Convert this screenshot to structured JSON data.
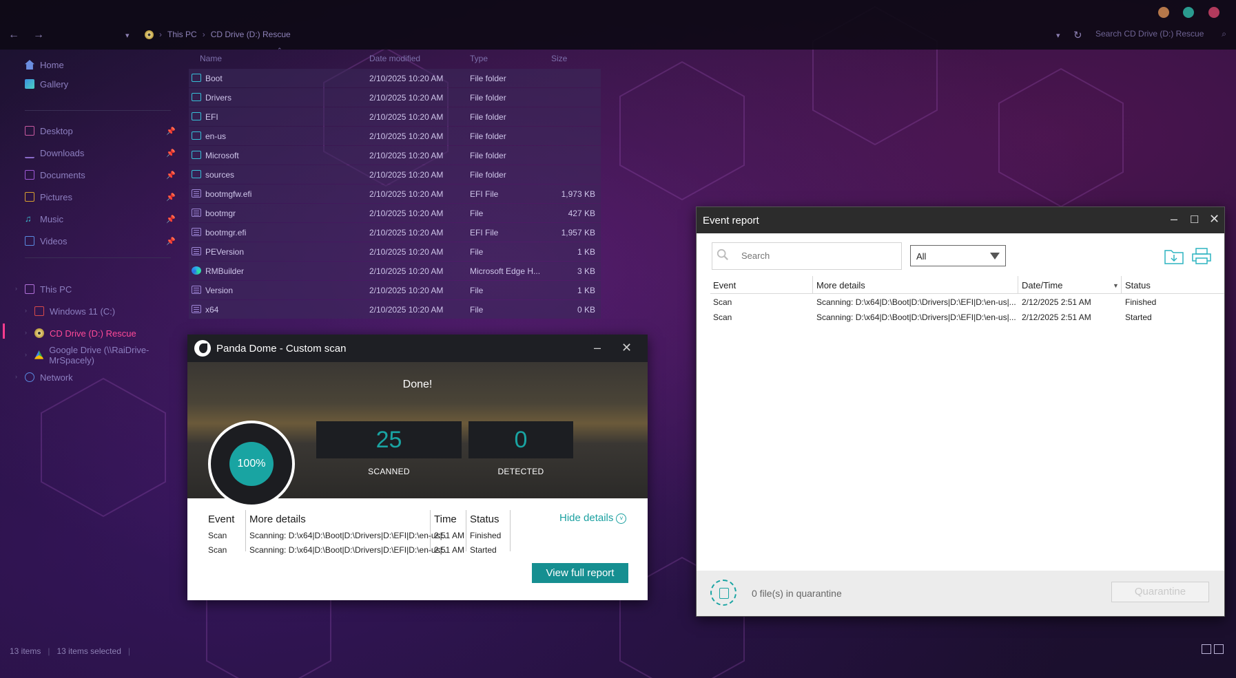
{
  "explorer": {
    "breadcrumb": [
      "This PC",
      "CD Drive (D:) Rescue"
    ],
    "search_placeholder": "Search CD Drive (D:) Rescue",
    "sidebar": {
      "top": [
        {
          "label": "Home",
          "icon": "home-icon"
        },
        {
          "label": "Gallery",
          "icon": "gallery-icon"
        }
      ],
      "pinned": [
        {
          "label": "Desktop",
          "icon": "desktop-icon"
        },
        {
          "label": "Downloads",
          "icon": "downloads-icon"
        },
        {
          "label": "Documents",
          "icon": "documents-icon"
        },
        {
          "label": "Pictures",
          "icon": "pictures-icon"
        },
        {
          "label": "Music",
          "icon": "music-icon"
        },
        {
          "label": "Videos",
          "icon": "videos-icon"
        }
      ],
      "tree": [
        {
          "label": "This PC",
          "icon": "pc-icon"
        },
        {
          "label": "Windows 11 (C:)",
          "icon": "drive-icon"
        },
        {
          "label": "CD Drive (D:) Rescue",
          "icon": "cd-icon",
          "selected": true
        },
        {
          "label": "Google Drive (\\\\RaiDrive-MrSpacely)",
          "icon": "google-drive-icon"
        },
        {
          "label": "Network",
          "icon": "network-icon"
        }
      ]
    },
    "columns": {
      "name": "Name",
      "date": "Date modified",
      "type": "Type",
      "size": "Size"
    },
    "files": [
      {
        "name": "Boot",
        "date": "2/10/2025 10:20 AM",
        "type": "File folder",
        "size": "",
        "icon": "folder"
      },
      {
        "name": "Drivers",
        "date": "2/10/2025 10:20 AM",
        "type": "File folder",
        "size": "",
        "icon": "folder"
      },
      {
        "name": "EFI",
        "date": "2/10/2025 10:20 AM",
        "type": "File folder",
        "size": "",
        "icon": "folder"
      },
      {
        "name": "en-us",
        "date": "2/10/2025 10:20 AM",
        "type": "File folder",
        "size": "",
        "icon": "folder"
      },
      {
        "name": "Microsoft",
        "date": "2/10/2025 10:20 AM",
        "type": "File folder",
        "size": "",
        "icon": "folder"
      },
      {
        "name": "sources",
        "date": "2/10/2025 10:20 AM",
        "type": "File folder",
        "size": "",
        "icon": "folder"
      },
      {
        "name": "bootmgfw.efi",
        "date": "2/10/2025 10:20 AM",
        "type": "EFI File",
        "size": "1,973 KB",
        "icon": "file"
      },
      {
        "name": "bootmgr",
        "date": "2/10/2025 10:20 AM",
        "type": "File",
        "size": "427 KB",
        "icon": "file"
      },
      {
        "name": "bootmgr.efi",
        "date": "2/10/2025 10:20 AM",
        "type": "EFI File",
        "size": "1,957 KB",
        "icon": "file"
      },
      {
        "name": "PEVersion",
        "date": "2/10/2025 10:20 AM",
        "type": "File",
        "size": "1 KB",
        "icon": "file"
      },
      {
        "name": "RMBuilder",
        "date": "2/10/2025 10:20 AM",
        "type": "Microsoft Edge H...",
        "size": "3 KB",
        "icon": "edge"
      },
      {
        "name": "Version",
        "date": "2/10/2025 10:20 AM",
        "type": "File",
        "size": "1 KB",
        "icon": "file"
      },
      {
        "name": "x64",
        "date": "2/10/2025 10:20 AM",
        "type": "File",
        "size": "0 KB",
        "icon": "file"
      }
    ],
    "status": {
      "items": "13 items",
      "selected": "13 items selected"
    }
  },
  "panda": {
    "title": "Panda Dome - Custom scan",
    "done": "Done!",
    "progress_pct": "100%",
    "progress_value": 1.0,
    "scanned_num": "25",
    "scanned_label": "SCANNED",
    "detected_num": "0",
    "detected_label": "DETECTED",
    "headers": {
      "event": "Event",
      "details": "More details",
      "time": "Time",
      "status": "Status"
    },
    "rows": [
      {
        "event": "Scan",
        "details": "Scanning: D:\\x64|D:\\Boot|D:\\Drivers|D:\\EFI|D:\\en-us|...",
        "time": "2:51 AM",
        "status": "Finished"
      },
      {
        "event": "Scan",
        "details": "Scanning: D:\\x64|D:\\Boot|D:\\Drivers|D:\\EFI|D:\\en-us|...",
        "time": "2:51 AM",
        "status": "Started"
      }
    ],
    "hide_details": "Hide details",
    "view_full_report": "View full report"
  },
  "event_report": {
    "title": "Event report",
    "search_placeholder": "Search",
    "filter_value": "All",
    "headers": {
      "event": "Event",
      "details": "More details",
      "datetime": "Date/Time",
      "status": "Status"
    },
    "rows": [
      {
        "event": "Scan",
        "details": "Scanning: D:\\x64|D:\\Boot|D:\\Drivers|D:\\EFI|D:\\en-us|...",
        "datetime": "2/12/2025 2:51 AM",
        "status": "Finished"
      },
      {
        "event": "Scan",
        "details": "Scanning: D:\\x64|D:\\Boot|D:\\Drivers|D:\\EFI|D:\\en-us|...",
        "datetime": "2/12/2025 2:51 AM",
        "status": "Started"
      }
    ],
    "quarantine_text": "0 file(s) in quarantine",
    "quarantine_button": "Quarantine"
  },
  "colors": {
    "accent_teal": "#19a4a2",
    "selection_pink": "#ff3c8e"
  }
}
